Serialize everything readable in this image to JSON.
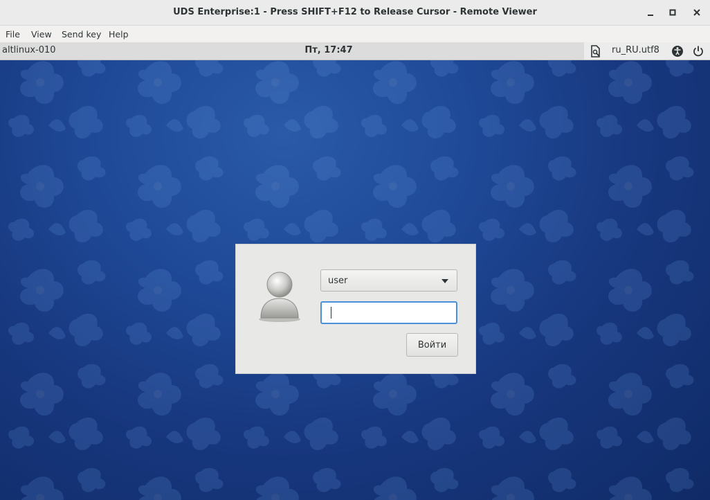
{
  "window": {
    "title": "UDS Enterprise:1 - Press SHIFT+F12 to Release Cursor - Remote Viewer",
    "controls": [
      "minimize-icon",
      "maximize-icon",
      "close-icon"
    ]
  },
  "menubar": {
    "items": [
      {
        "label": "File"
      },
      {
        "label": "View"
      },
      {
        "label": "Send key"
      },
      {
        "label": "Help"
      }
    ]
  },
  "remote": {
    "panel": {
      "hostname": "altlinux-010",
      "clock": "Пт, 17:47",
      "locale": "ru_RU.utf8",
      "tray_icons": [
        "session-document-icon",
        "accessibility-icon",
        "power-icon"
      ]
    },
    "login": {
      "user": "user",
      "password": "",
      "login_button": "Войти",
      "avatar_icon": "user-avatar-icon"
    }
  },
  "colors": {
    "background_blue": "#1f4a98",
    "focus_border": "#4a90d9",
    "dialog_bg": "#e8e8e7"
  }
}
